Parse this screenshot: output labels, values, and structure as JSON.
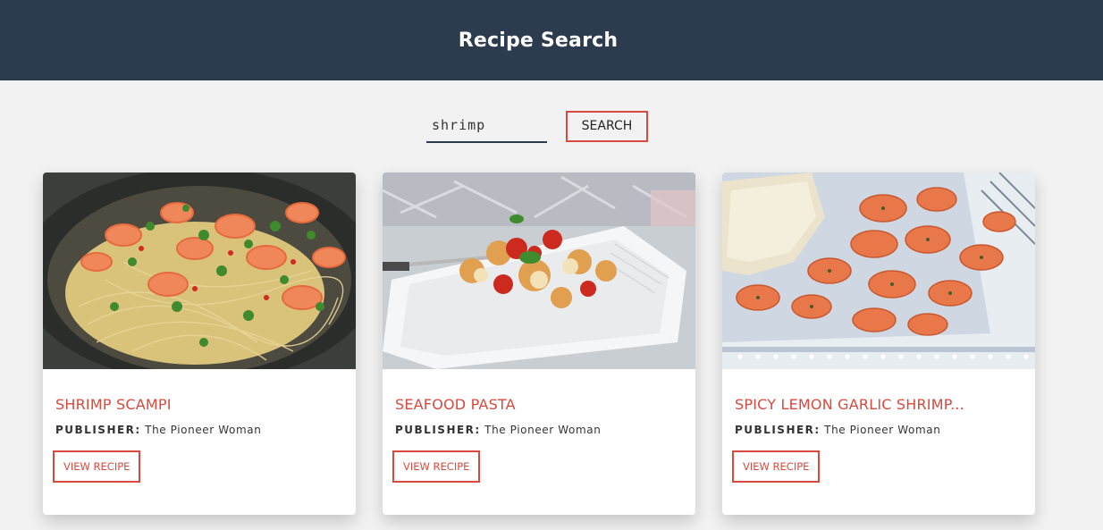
{
  "header": {
    "title": "Recipe Search"
  },
  "search": {
    "value": "shrimp",
    "button_label": "SEARCH"
  },
  "cards": [
    {
      "title": "SHRIMP SCAMPI",
      "publisher_label": "PUBLISHER:",
      "publisher": "The Pioneer Woman",
      "button_label": "VIEW RECIPE",
      "image": "shrimp-scampi-photo"
    },
    {
      "title": "SEAFOOD PASTA",
      "publisher_label": "PUBLISHER:",
      "publisher": "The Pioneer Woman",
      "button_label": "VIEW RECIPE",
      "image": "seafood-pasta-photo"
    },
    {
      "title": "SPICY LEMON GARLIC SHRIMP...",
      "publisher_label": "PUBLISHER:",
      "publisher": "The Pioneer Woman",
      "button_label": "VIEW RECIPE",
      "image": "spicy-lemon-garlic-shrimp-photo"
    }
  ],
  "colors": {
    "header_bg": "#2d3b4f",
    "accent": "#d9493e",
    "page_bg": "#f2f2f2"
  }
}
